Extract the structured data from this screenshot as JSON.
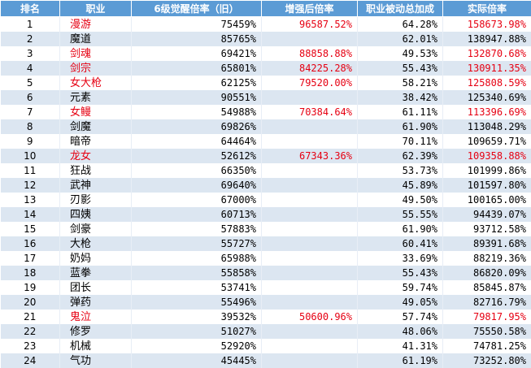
{
  "header": {
    "rank": "排名",
    "job": "职业",
    "awaken": "6级觉醒倍率（旧）",
    "enhanced": "增强后倍率",
    "passive": "职业被动总加成",
    "actual": "实际倍率"
  },
  "colors": {
    "header_bg": "#5b9bd5",
    "stripe": "#dce6f1",
    "highlight": "#e60012"
  },
  "rows": [
    {
      "rank": "1",
      "job": "漫游",
      "awaken": "75459%",
      "enhanced": "96587.52%",
      "passive": "64.28%",
      "actual": "158673.98%",
      "highlight": true
    },
    {
      "rank": "2",
      "job": "魔道",
      "awaken": "85765%",
      "enhanced": "",
      "passive": "62.01%",
      "actual": "138947.88%",
      "highlight": false
    },
    {
      "rank": "3",
      "job": "剑魂",
      "awaken": "69421%",
      "enhanced": "88858.88%",
      "passive": "49.53%",
      "actual": "132870.68%",
      "highlight": true
    },
    {
      "rank": "4",
      "job": "剑宗",
      "awaken": "65801%",
      "enhanced": "84225.28%",
      "passive": "55.43%",
      "actual": "130911.35%",
      "highlight": true
    },
    {
      "rank": "5",
      "job": "女大枪",
      "awaken": "62125%",
      "enhanced": "79520.00%",
      "passive": "58.21%",
      "actual": "125808.59%",
      "highlight": true
    },
    {
      "rank": "6",
      "job": "元素",
      "awaken": "90551%",
      "enhanced": "",
      "passive": "38.42%",
      "actual": "125340.69%",
      "highlight": false
    },
    {
      "rank": "7",
      "job": "女鳗",
      "awaken": "54988%",
      "enhanced": "70384.64%",
      "passive": "61.11%",
      "actual": "113396.69%",
      "highlight": true
    },
    {
      "rank": "8",
      "job": "剑魔",
      "awaken": "69826%",
      "enhanced": "",
      "passive": "61.90%",
      "actual": "113048.29%",
      "highlight": false
    },
    {
      "rank": "9",
      "job": "暗帝",
      "awaken": "64464%",
      "enhanced": "",
      "passive": "70.11%",
      "actual": "109659.71%",
      "highlight": false
    },
    {
      "rank": "10",
      "job": "龙女",
      "awaken": "52612%",
      "enhanced": "67343.36%",
      "passive": "62.39%",
      "actual": "109358.88%",
      "highlight": true
    },
    {
      "rank": "11",
      "job": "狂战",
      "awaken": "66350%",
      "enhanced": "",
      "passive": "53.73%",
      "actual": "101999.86%",
      "highlight": false
    },
    {
      "rank": "12",
      "job": "武神",
      "awaken": "69640%",
      "enhanced": "",
      "passive": "45.89%",
      "actual": "101597.80%",
      "highlight": false
    },
    {
      "rank": "13",
      "job": "刃影",
      "awaken": "67000%",
      "enhanced": "",
      "passive": "49.50%",
      "actual": "100165.00%",
      "highlight": false
    },
    {
      "rank": "14",
      "job": "四姨",
      "awaken": "60713%",
      "enhanced": "",
      "passive": "55.55%",
      "actual": "94439.07%",
      "highlight": false
    },
    {
      "rank": "15",
      "job": "剑豪",
      "awaken": "57883%",
      "enhanced": "",
      "passive": "61.90%",
      "actual": "93712.58%",
      "highlight": false
    },
    {
      "rank": "16",
      "job": "大枪",
      "awaken": "55727%",
      "enhanced": "",
      "passive": "60.41%",
      "actual": "89391.68%",
      "highlight": false
    },
    {
      "rank": "17",
      "job": "奶妈",
      "awaken": "65988%",
      "enhanced": "",
      "passive": "33.69%",
      "actual": "88219.36%",
      "highlight": false
    },
    {
      "rank": "18",
      "job": "蓝拳",
      "awaken": "55858%",
      "enhanced": "",
      "passive": "55.43%",
      "actual": "86820.09%",
      "highlight": false
    },
    {
      "rank": "19",
      "job": "团长",
      "awaken": "53741%",
      "enhanced": "",
      "passive": "59.74%",
      "actual": "85845.87%",
      "highlight": false
    },
    {
      "rank": "20",
      "job": "弹药",
      "awaken": "55496%",
      "enhanced": "",
      "passive": "49.05%",
      "actual": "82716.79%",
      "highlight": false
    },
    {
      "rank": "21",
      "job": "鬼泣",
      "awaken": "39532%",
      "enhanced": "50600.96%",
      "passive": "57.74%",
      "actual": "79817.95%",
      "highlight": true
    },
    {
      "rank": "22",
      "job": "修罗",
      "awaken": "51027%",
      "enhanced": "",
      "passive": "48.06%",
      "actual": "75550.58%",
      "highlight": false
    },
    {
      "rank": "23",
      "job": "机械",
      "awaken": "52920%",
      "enhanced": "",
      "passive": "41.31%",
      "actual": "74781.25%",
      "highlight": false
    },
    {
      "rank": "24",
      "job": "气功",
      "awaken": "45445%",
      "enhanced": "",
      "passive": "61.19%",
      "actual": "73252.80%",
      "highlight": false
    }
  ]
}
